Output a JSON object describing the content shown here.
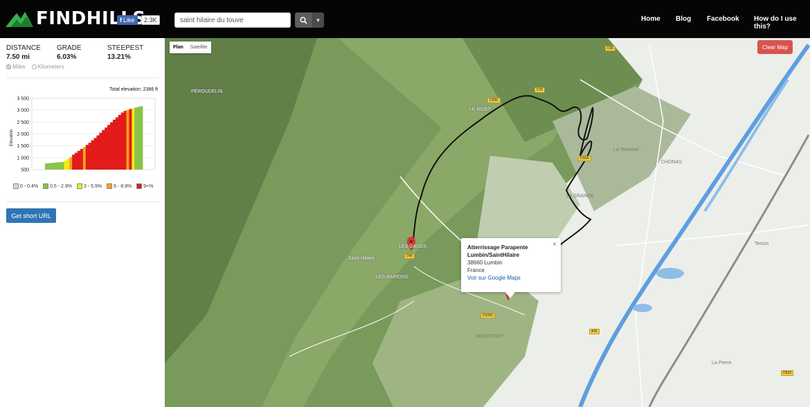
{
  "header": {
    "logo_text": "FINDHILLS",
    "like_label": "Like",
    "like_count": "2.3K",
    "search_value": "saint hilaire du touve",
    "nav": [
      "Home",
      "Blog",
      "Facebook",
      "How do I use this?"
    ]
  },
  "stats": {
    "distance_label": "DISTANCE",
    "distance_value": "7.50 mi",
    "grade_label": "GRADE",
    "grade_value": "6.03%",
    "steepest_label": "STEEPEST",
    "steepest_value": "13.21%"
  },
  "units": {
    "miles": "Miles",
    "kilometers": "Kilometers",
    "selected": "Miles"
  },
  "chart_data": {
    "type": "bar",
    "title": "Total elevation: 2386 ft",
    "ylabel": "Elevation",
    "ylim": [
      500,
      3500
    ],
    "y_ticks": [
      "3 500",
      "3 000",
      "2 500",
      "2 000",
      "1 500",
      "1 000",
      "500"
    ],
    "bins": [
      {
        "color": "#8bc34a",
        "heights": [
          760,
          770,
          780,
          790,
          800,
          810,
          820
        ]
      },
      {
        "color": "#f1ea16",
        "heights": [
          880,
          950
        ]
      },
      {
        "color": "#f7a21b",
        "heights": [
          1030
        ]
      },
      {
        "color": "#e31b1b",
        "heights": [
          1130,
          1210,
          1290,
          1370
        ]
      },
      {
        "color": "#f7a21b",
        "heights": [
          1450
        ]
      },
      {
        "color": "#e31b1b",
        "heights": [
          1540,
          1630,
          1730,
          1830,
          1940,
          2050,
          2160,
          2270,
          2380,
          2490,
          2600,
          2700,
          2800,
          2900,
          2970
        ]
      },
      {
        "color": "#f7a21b",
        "heights": [
          3010
        ]
      },
      {
        "color": "#e31b1b",
        "heights": [
          3050
        ]
      },
      {
        "color": "#f1ea16",
        "heights": [
          3080
        ]
      },
      {
        "color": "#8bc34a",
        "heights": [
          3110,
          3140,
          3170
        ]
      }
    ],
    "legend": [
      {
        "label": "0 - 0.4%",
        "color": "#d9d9d9"
      },
      {
        "label": "0.5 - 2.9%",
        "color": "#8bc34a"
      },
      {
        "label": "3 - 5.9%",
        "color": "#f1ea16"
      },
      {
        "label": "6 - 8.9%",
        "color": "#f7a21b"
      },
      {
        "label": "9+%",
        "color": "#e31b1b"
      }
    ]
  },
  "buttons": {
    "short_url": "Get short URL",
    "clear_map": "Clear Map"
  },
  "map": {
    "type_options": [
      "Plan",
      "Satellite"
    ],
    "type_selected": "Plan",
    "info_title": "Atterrissage Parapente Lumbin/SaintHilaire",
    "info_postcode": "38660 Lumbin",
    "info_country": "France",
    "info_link": "Voir sur Google Maps",
    "info_close": "×",
    "places": [
      "Saint-Hilaire",
      "LES GAUDS",
      "LES BARIONS",
      "MONTFORT",
      "Tencin",
      "La Pierre",
      "La Terrasse",
      "CHONAS",
      "PÉROUDELIN",
      "LE RIVET",
      "LA GRANDE"
    ],
    "roads": [
      "D30",
      "D29",
      "D30E",
      "D90",
      "D1090",
      "D30A",
      "A41",
      "D523"
    ]
  }
}
